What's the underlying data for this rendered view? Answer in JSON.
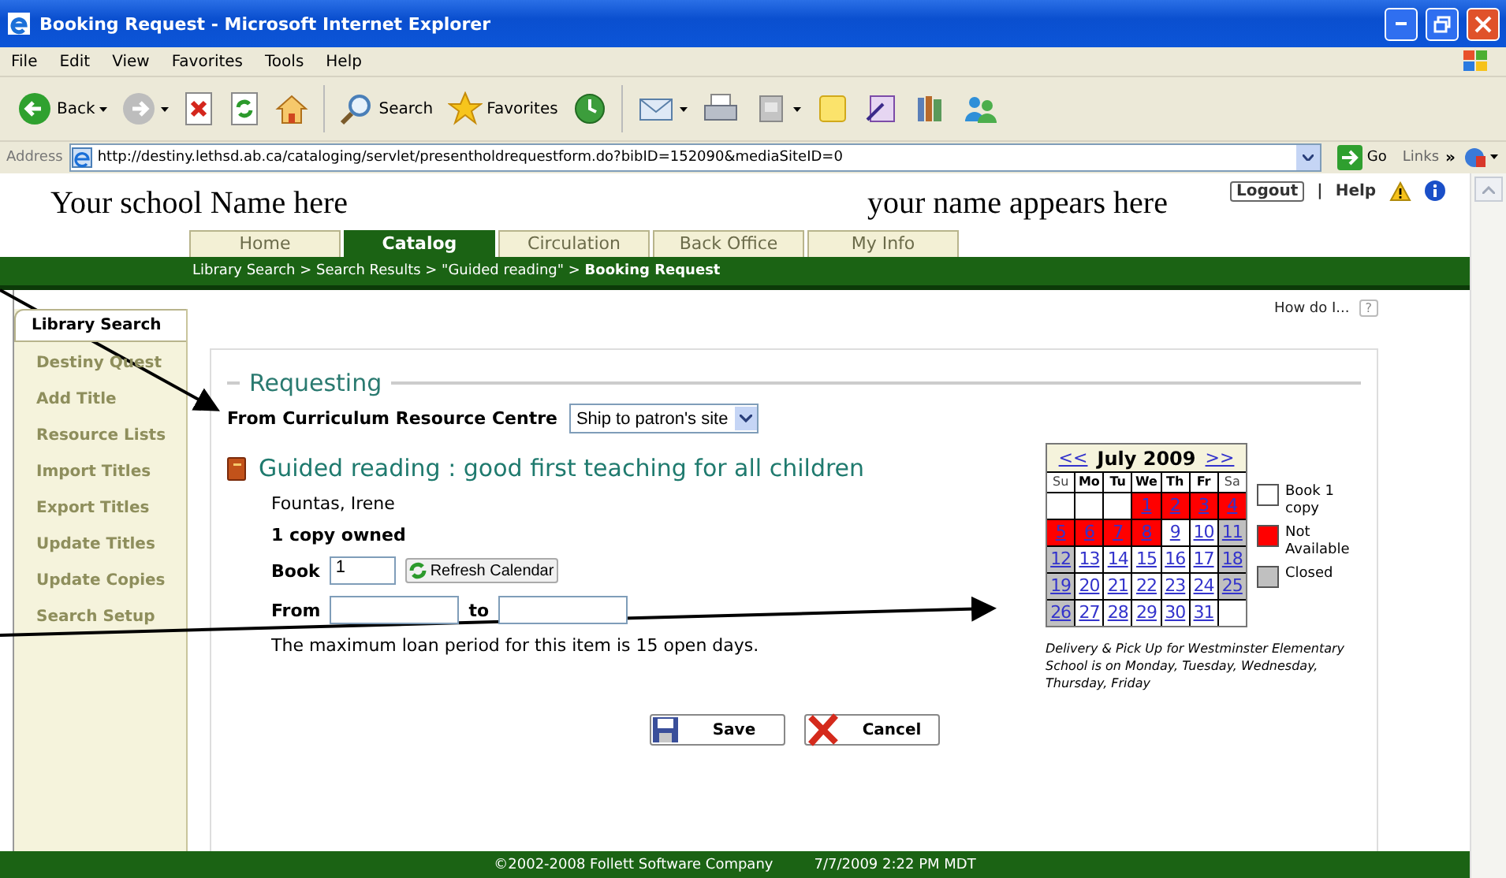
{
  "window": {
    "title": "Booking Request - Microsoft Internet Explorer"
  },
  "menu": [
    "File",
    "Edit",
    "View",
    "Favorites",
    "Tools",
    "Help"
  ],
  "toolbar": [
    {
      "kind": "back",
      "label": "Back"
    },
    {
      "kind": "forward"
    },
    {
      "kind": "stop"
    },
    {
      "kind": "refresh"
    },
    {
      "kind": "home"
    },
    {
      "kind": "search",
      "label": "Search"
    },
    {
      "kind": "favorites",
      "label": "Favorites"
    },
    {
      "kind": "history"
    },
    {
      "kind": "mail"
    },
    {
      "kind": "print"
    },
    {
      "kind": "edit"
    },
    {
      "kind": "note"
    },
    {
      "kind": "research"
    },
    {
      "kind": "books"
    },
    {
      "kind": "messenger"
    }
  ],
  "address": {
    "label": "Address",
    "url": "http://destiny.lethsd.ab.ca/cataloging/servlet/presentholdrequestform.do?bibID=152090&mediaSiteID=0",
    "go": "Go",
    "links": "Links",
    "links_more": "»"
  },
  "header": {
    "school": "Your school Name here",
    "user": "your name appears here",
    "logout": "Logout",
    "separator": "|",
    "help": "Help"
  },
  "tabs": [
    {
      "label": "Home",
      "selected": false
    },
    {
      "label": "Catalog",
      "selected": true
    },
    {
      "label": "Circulation",
      "selected": false
    },
    {
      "label": "Back Office",
      "selected": false
    },
    {
      "label": "My Info",
      "selected": false
    }
  ],
  "breadcrumb": "Library Search > Search Results > \"Guided reading\" > **Booking Request**",
  "sidebar": [
    {
      "label": "Library Search",
      "selected": true
    },
    {
      "label": "Destiny Quest",
      "selected": false
    },
    {
      "label": "Add Title",
      "selected": false
    },
    {
      "label": "Resource Lists",
      "selected": false
    },
    {
      "label": "Import Titles",
      "selected": false
    },
    {
      "label": "Export Titles",
      "selected": false
    },
    {
      "label": "Update Titles",
      "selected": false
    },
    {
      "label": "Update Copies",
      "selected": false
    },
    {
      "label": "Search Setup",
      "selected": false
    }
  ],
  "how_do_i": {
    "label": "How do I...",
    "icon": "?"
  },
  "request": {
    "legend": "Requesting",
    "from_label": "From Curriculum Resource Centre",
    "ship": "Ship to patron's site",
    "title": "Guided reading : good first teaching for all children",
    "author": "Fountas, Irene",
    "copies": "1 copy owned",
    "book_label": "Book",
    "book_value": "1",
    "refresh": "Refresh Calendar",
    "from": "From",
    "to": "to",
    "note": "The maximum loan period for this item is 15 open days."
  },
  "calendar": {
    "prev": "<<",
    "month": "July 2009",
    "next": ">>",
    "weekdays": [
      {
        "label": "Su",
        "kind": "closed"
      },
      {
        "label": "Mo",
        "kind": "open"
      },
      {
        "label": "Tu",
        "kind": "open"
      },
      {
        "label": "We",
        "kind": "open"
      },
      {
        "label": "Th",
        "kind": "open"
      },
      {
        "label": "Fr",
        "kind": "open"
      },
      {
        "label": "Sa",
        "kind": "closed"
      }
    ],
    "days": [
      {
        "kind": "blank"
      },
      {
        "kind": "blank"
      },
      {
        "kind": "blank"
      },
      {
        "day": "1",
        "kind": "not_available"
      },
      {
        "day": "2",
        "kind": "not_available"
      },
      {
        "day": "3",
        "kind": "not_available"
      },
      {
        "day": "4",
        "kind": "not_available"
      },
      {
        "day": "5",
        "kind": "not_available"
      },
      {
        "day": "6",
        "kind": "not_available"
      },
      {
        "day": "7",
        "kind": "not_available"
      },
      {
        "day": "8",
        "kind": "not_available"
      },
      {
        "day": "9",
        "kind": "open"
      },
      {
        "day": "10",
        "kind": "open"
      },
      {
        "day": "11",
        "kind": "closed"
      },
      {
        "day": "12",
        "kind": "closed"
      },
      {
        "day": "13",
        "kind": "open"
      },
      {
        "day": "14",
        "kind": "open"
      },
      {
        "day": "15",
        "kind": "open"
      },
      {
        "day": "16",
        "kind": "open"
      },
      {
        "day": "17",
        "kind": "open"
      },
      {
        "day": "18",
        "kind": "closed"
      },
      {
        "day": "19",
        "kind": "closed"
      },
      {
        "day": "20",
        "kind": "open"
      },
      {
        "day": "21",
        "kind": "open"
      },
      {
        "day": "22",
        "kind": "open"
      },
      {
        "day": "23",
        "kind": "open"
      },
      {
        "day": "24",
        "kind": "open"
      },
      {
        "day": "25",
        "kind": "closed"
      },
      {
        "day": "26",
        "kind": "closed"
      },
      {
        "day": "27",
        "kind": "open"
      },
      {
        "day": "28",
        "kind": "open"
      },
      {
        "day": "29",
        "kind": "open"
      },
      {
        "day": "30",
        "kind": "open"
      },
      {
        "day": "31",
        "kind": "open"
      },
      {
        "kind": "blank"
      }
    ],
    "legend": [
      {
        "kind": "open",
        "label": "Book 1 copy"
      },
      {
        "kind": "not_available",
        "label": "Not Available"
      },
      {
        "kind": "closed",
        "label": "Closed"
      }
    ],
    "delivery": "Delivery & Pick Up for Westminster Elementary School is on Monday, Tuesday, Wednesday, Thursday, Friday"
  },
  "buttons": [
    {
      "kind": "save",
      "label": "Save"
    },
    {
      "kind": "cancel",
      "label": "Cancel"
    }
  ],
  "footer": {
    "copyright": "©2002-2008 Follett Software Company",
    "datetime": "7/7/2009 2:22 PM MDT"
  }
}
